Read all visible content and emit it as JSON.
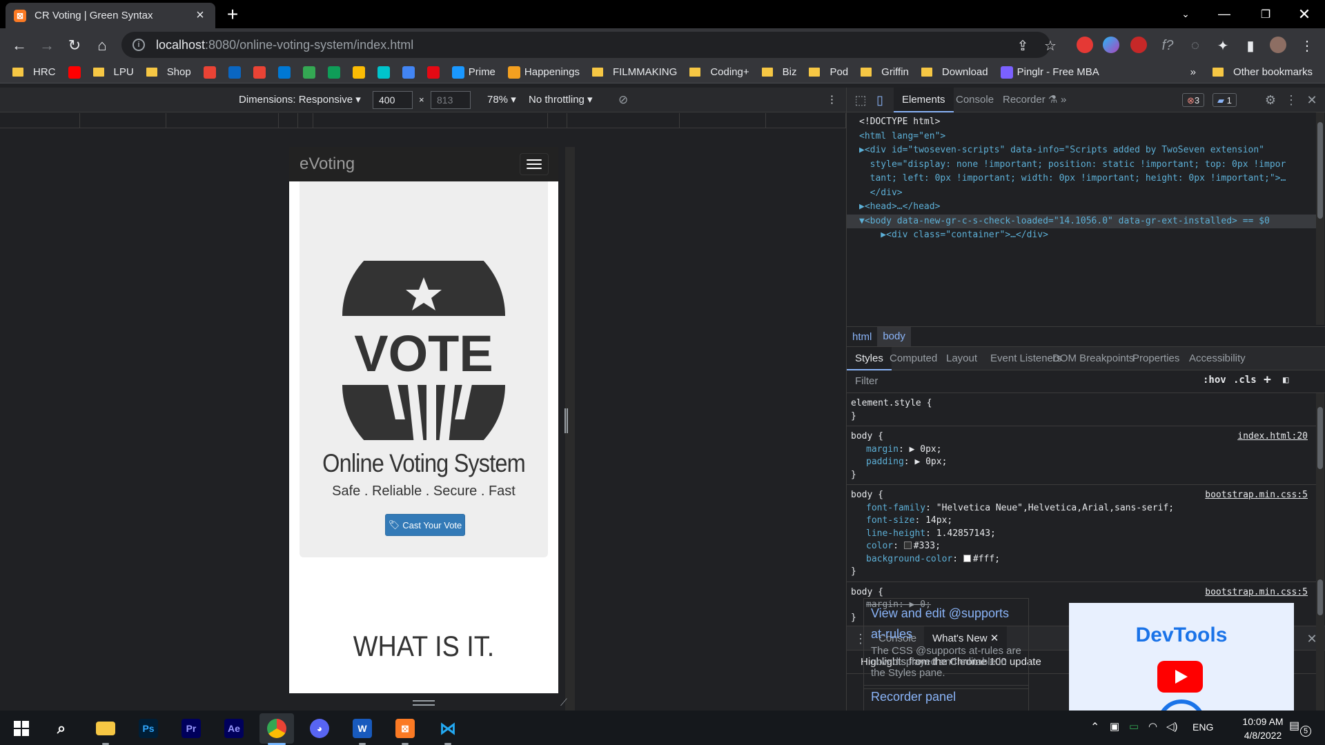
{
  "browser": {
    "tab_title": "CR Voting | Green Syntax",
    "url_host": "localhost",
    "url_rest": ":8080/online-voting-system/index.html"
  },
  "bookmarks": [
    {
      "label": "HRC",
      "type": "folder"
    },
    {
      "label": "",
      "type": "icon",
      "icon": "youtube-icon",
      "color": "#ff0000"
    },
    {
      "label": "LPU",
      "type": "folder"
    },
    {
      "label": "Shop",
      "type": "folder"
    },
    {
      "label": "",
      "type": "icon",
      "icon": "triangle-icon",
      "color": "#ea4335"
    },
    {
      "label": "",
      "type": "icon",
      "icon": "linkedin-icon",
      "color": "#0a66c2"
    },
    {
      "label": "",
      "type": "icon",
      "icon": "gmail-icon",
      "color": "#ea4335"
    },
    {
      "label": "",
      "type": "icon",
      "icon": "outlook-icon",
      "color": "#0078d4"
    },
    {
      "label": "",
      "type": "icon",
      "icon": "drive-icon",
      "color": "#34a853"
    },
    {
      "label": "",
      "type": "icon",
      "icon": "classroom-icon",
      "color": "#0f9d58"
    },
    {
      "label": "",
      "type": "icon",
      "icon": "keep-icon",
      "color": "#fbbc04"
    },
    {
      "label": "",
      "type": "icon",
      "icon": "canva-icon",
      "color": "#00c4cc"
    },
    {
      "label": "",
      "type": "icon",
      "icon": "podcast-icon",
      "color": "#4285f4"
    },
    {
      "label": "",
      "type": "icon",
      "icon": "netflix-icon",
      "color": "#e50914"
    },
    {
      "label": "Prime",
      "type": "icon",
      "icon": "prime-icon",
      "color": "#1a98ff"
    },
    {
      "label": "Happenings",
      "type": "icon",
      "icon": "happenings-icon",
      "color": "#f4a020"
    },
    {
      "label": "FILMMAKING",
      "type": "folder"
    },
    {
      "label": "Coding+",
      "type": "folder"
    },
    {
      "label": "Biz",
      "type": "folder"
    },
    {
      "label": "Pod",
      "type": "folder"
    },
    {
      "label": "Griffin",
      "type": "folder"
    },
    {
      "label": "Download",
      "type": "folder"
    },
    {
      "label": "Pinglr - Free MBA",
      "type": "icon",
      "icon": "pinglr-icon",
      "color": "#7b61ff"
    }
  ],
  "other_bookmarks": "Other bookmarks",
  "device_toolbar": {
    "dimensions": "Dimensions: Responsive",
    "width": "400",
    "height": "813",
    "times": "×",
    "zoom": "78%",
    "throttling": "No throttling"
  },
  "site": {
    "brand": "eVoting",
    "logo_text": "VOTE",
    "title": "Online Voting System",
    "tagline": "Safe . Reliable . Secure . Fast",
    "cta": "Cast Your Vote",
    "section_heading": "WHAT IS IT."
  },
  "devtools": {
    "tabs": [
      "Elements",
      "Console",
      "Recorder",
      "»"
    ],
    "error_count": "3",
    "message_count": "1",
    "dom_lines": [
      {
        "kind": "plain",
        "text": "<!DOCTYPE html>"
      },
      {
        "kind": "html",
        "text": "<html lang=\"en\">"
      },
      {
        "kind": "div1",
        "text": "▶<div id=\"twoseven-scripts\" data-info=\"Scripts added by TwoSeven extension\""
      },
      {
        "kind": "cont",
        "text": "style=\"display: none !important; position: static !important; top: 0px !impor"
      },
      {
        "kind": "cont",
        "text": "tant; left: 0px !important; width: 0px !important; height: 0px !important;\">…"
      },
      {
        "kind": "cont",
        "text": "</div>"
      },
      {
        "kind": "head",
        "text": "▶<head>…</head>"
      },
      {
        "kind": "body",
        "text": "▼<body data-new-gr-c-s-check-loaded=\"14.1056.0\" data-gr-ext-installed> == $0"
      },
      {
        "kind": "cont",
        "text": "  ▶<div class=\"container\">…</div>"
      }
    ],
    "breadcrumbs": [
      "html",
      "body"
    ],
    "styles_tabs": [
      "Styles",
      "Computed",
      "Layout",
      "Event Listeners",
      "DOM Breakpoints",
      "Properties",
      "Accessibility"
    ],
    "filter_placeholder": "Filter",
    "hov": ":hov",
    "cls": ".cls",
    "rules": [
      {
        "selector": "element.style",
        "source": "",
        "props": []
      },
      {
        "selector": "body",
        "source": "index.html:20",
        "props": [
          {
            "name": "margin",
            "value": "▶ 0px;",
            "struck": false
          },
          {
            "name": "padding",
            "value": "▶ 0px;",
            "struck": false
          }
        ]
      },
      {
        "selector": "body",
        "source": "bootstrap.min.css:5",
        "props": [
          {
            "name": "font-family",
            "value": "\"Helvetica Neue\",Helvetica,Arial,sans-serif;",
            "struck": false
          },
          {
            "name": "font-size",
            "value": "14px;",
            "struck": false
          },
          {
            "name": "line-height",
            "value": "1.42857143;",
            "struck": false
          },
          {
            "name": "color",
            "value": "#333;",
            "struck": false,
            "swatch": "#333333"
          },
          {
            "name": "background-color",
            "value": "#fff;",
            "struck": false,
            "swatch": "#ffffff"
          }
        ]
      },
      {
        "selector": "body",
        "source": "bootstrap.min.css:5",
        "props": [
          {
            "name": "margin",
            "value": "▶ 0;",
            "struck": true
          }
        ]
      }
    ],
    "drawer_tabs": [
      "Console",
      "What's New"
    ],
    "whats_new_header": "Highlights from the Chrome 100 update",
    "whats_new_card_title": "View and edit @supports at-rules",
    "whats_new_card_desc": "The CSS @supports at-rules are now displayed and editable in the Styles pane.",
    "whats_new_card2_title": "Recorder panel",
    "thumb_text": "DevTools"
  },
  "taskbar": {
    "apps": [
      "start",
      "search",
      "file-explorer",
      "photoshop",
      "premiere",
      "after-effects",
      "chrome",
      "discord",
      "word",
      "xampp",
      "vscode"
    ],
    "lang": "ENG",
    "time": "10:09 AM",
    "date": "4/8/2022",
    "notif_count": "5"
  },
  "colors": {
    "accent_blue": "#337ab7",
    "navbar": "#222222",
    "jumbotron": "#eeeeee",
    "devtools_link": "#8ab4f8"
  }
}
